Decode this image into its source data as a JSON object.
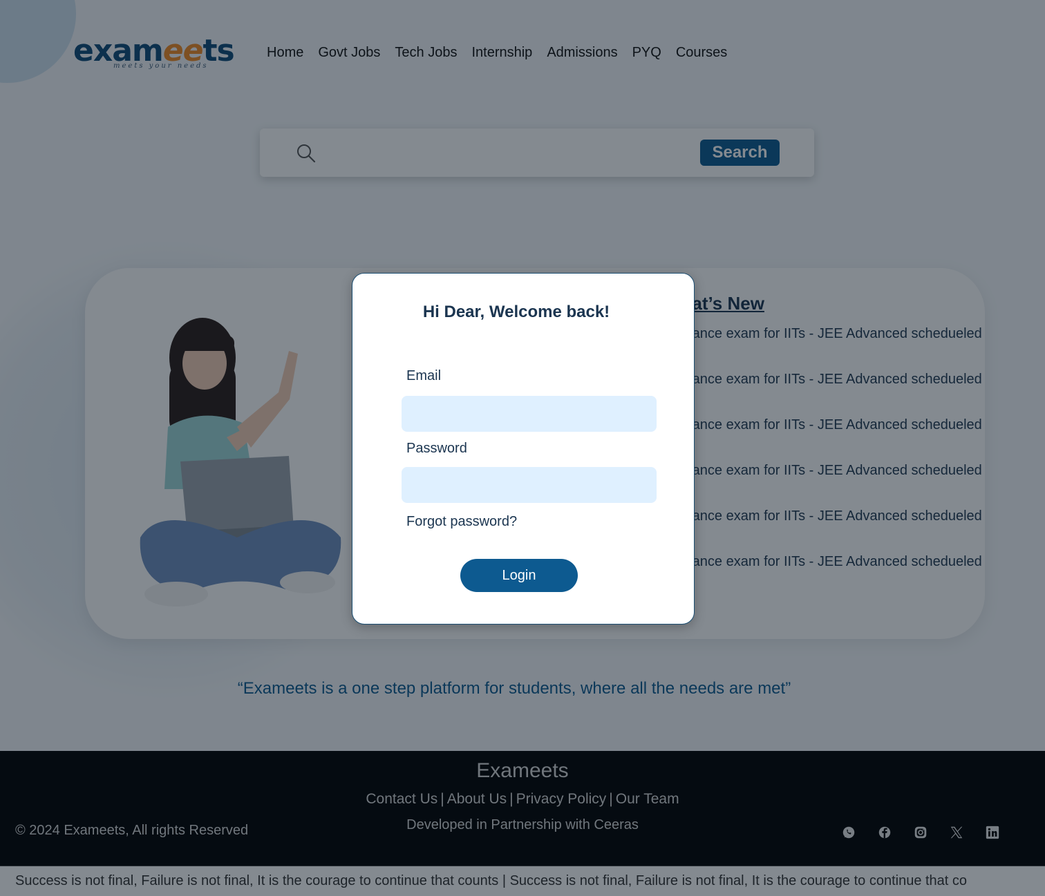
{
  "brand": {
    "logo_text_a": "exam",
    "logo_text_b": "ee",
    "logo_text_c": "ts",
    "logo_tagline": "meets your needs",
    "colors": {
      "primary": "#0d5a90",
      "accent": "#f08a24",
      "dark": "#1b3550"
    }
  },
  "nav": {
    "items": [
      "Home",
      "Govt Jobs",
      "Tech Jobs",
      "Internship",
      "Admissions",
      "PYQ",
      "Courses"
    ]
  },
  "search": {
    "placeholder": "",
    "button_label": "Search",
    "icon": "search-icon"
  },
  "whats_new": {
    "title": "What’s New",
    "items": [
      "Entrance exam for IITs - JEE Advanced schedueled",
      "Entrance exam for IITs - JEE Advanced schedueled",
      "Entrance exam for IITs - JEE Advanced schedueled",
      "Entrance exam for IITs - JEE Advanced schedueled",
      "Entrance exam for IITs - JEE Advanced schedueled",
      "Entrance exam for IITs - JEE Advanced schedueled"
    ]
  },
  "quote": "“Exameets is a one step platform for students, where all the needs are met”",
  "footer": {
    "brand": "Exameets",
    "links": [
      "Contact Us",
      "About Us",
      "Privacy Policy",
      "Our Team"
    ],
    "partner": "Developed in Partnership with Ceeras",
    "copyright": "© 2024 Exameets, All rights Reserved",
    "socials": [
      "whatsapp-icon",
      "facebook-icon",
      "instagram-icon",
      "x-icon",
      "linkedin-icon"
    ],
    "ticker": "Success is not final, Failure is not final, It is the courage to continue that counts | Success is not final, Failure is not final, It is the courage to continue that co"
  },
  "login_modal": {
    "title": "Hi Dear, Welcome back!",
    "email_label": "Email",
    "email_value": "",
    "password_label": "Password",
    "password_value": "",
    "forgot_label": "Forgot password?",
    "login_label": "Login"
  }
}
